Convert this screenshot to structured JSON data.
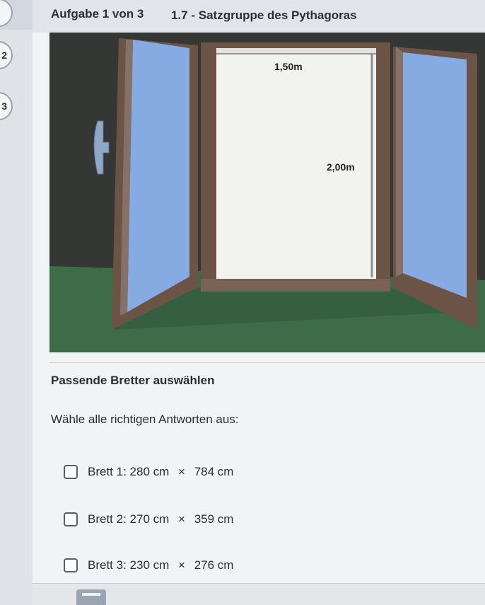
{
  "header": {
    "task_counter": "Aufgabe 1 von 3",
    "task_title": "1.7 - Satzgruppe des Pythagoras"
  },
  "sidebar": {
    "steps": [
      "",
      "2",
      "3"
    ]
  },
  "illustration": {
    "width_label": "1,50m",
    "height_label": "2,00m"
  },
  "question": {
    "title": "Passende Bretter auswählen",
    "instruction": "Wähle alle richtigen Antworten aus:",
    "options": [
      {
        "label": "Brett 1:",
        "a": "280 cm",
        "b": "784 cm"
      },
      {
        "label": "Brett 2:",
        "a": "270 cm",
        "b": "359 cm"
      },
      {
        "label": "Brett 3:",
        "a": "230 cm",
        "b": "276 cm"
      }
    ],
    "times_symbol": "×"
  },
  "colors": {
    "floor": "#3e6b48",
    "frame": "#6b5446",
    "glass": "#7fa6e0",
    "opening": "#f2f2ee"
  },
  "icons": {
    "footer_button": "calculator-icon"
  }
}
